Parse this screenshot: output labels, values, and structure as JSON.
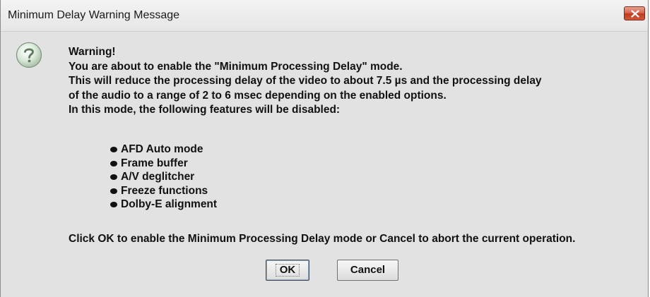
{
  "window": {
    "title": "Minimum Delay Warning Message"
  },
  "icons": {
    "question": "question-icon",
    "close": "close-icon"
  },
  "message": {
    "lines": [
      "Warning!",
      "You are about to enable the \"Minimum Processing Delay\" mode.",
      "This will reduce the processing delay of the video to about 7.5 µs and the processing delay",
      "of the audio to a range of 2 to 6 msec depending on the enabled options.",
      "In this mode, the following features will be disabled:"
    ],
    "features": [
      "AFD Auto mode",
      "Frame buffer",
      "A/V deglitcher",
      "Freeze functions",
      "Dolby-E alignment"
    ],
    "instruction": "Click OK to enable the Minimum Processing Delay mode or Cancel to abort the current operation."
  },
  "buttons": {
    "ok_label": "OK",
    "cancel_label": "Cancel"
  },
  "colors": {
    "close_button": "#c9452c",
    "dialog_background": "#e2e2e2"
  }
}
